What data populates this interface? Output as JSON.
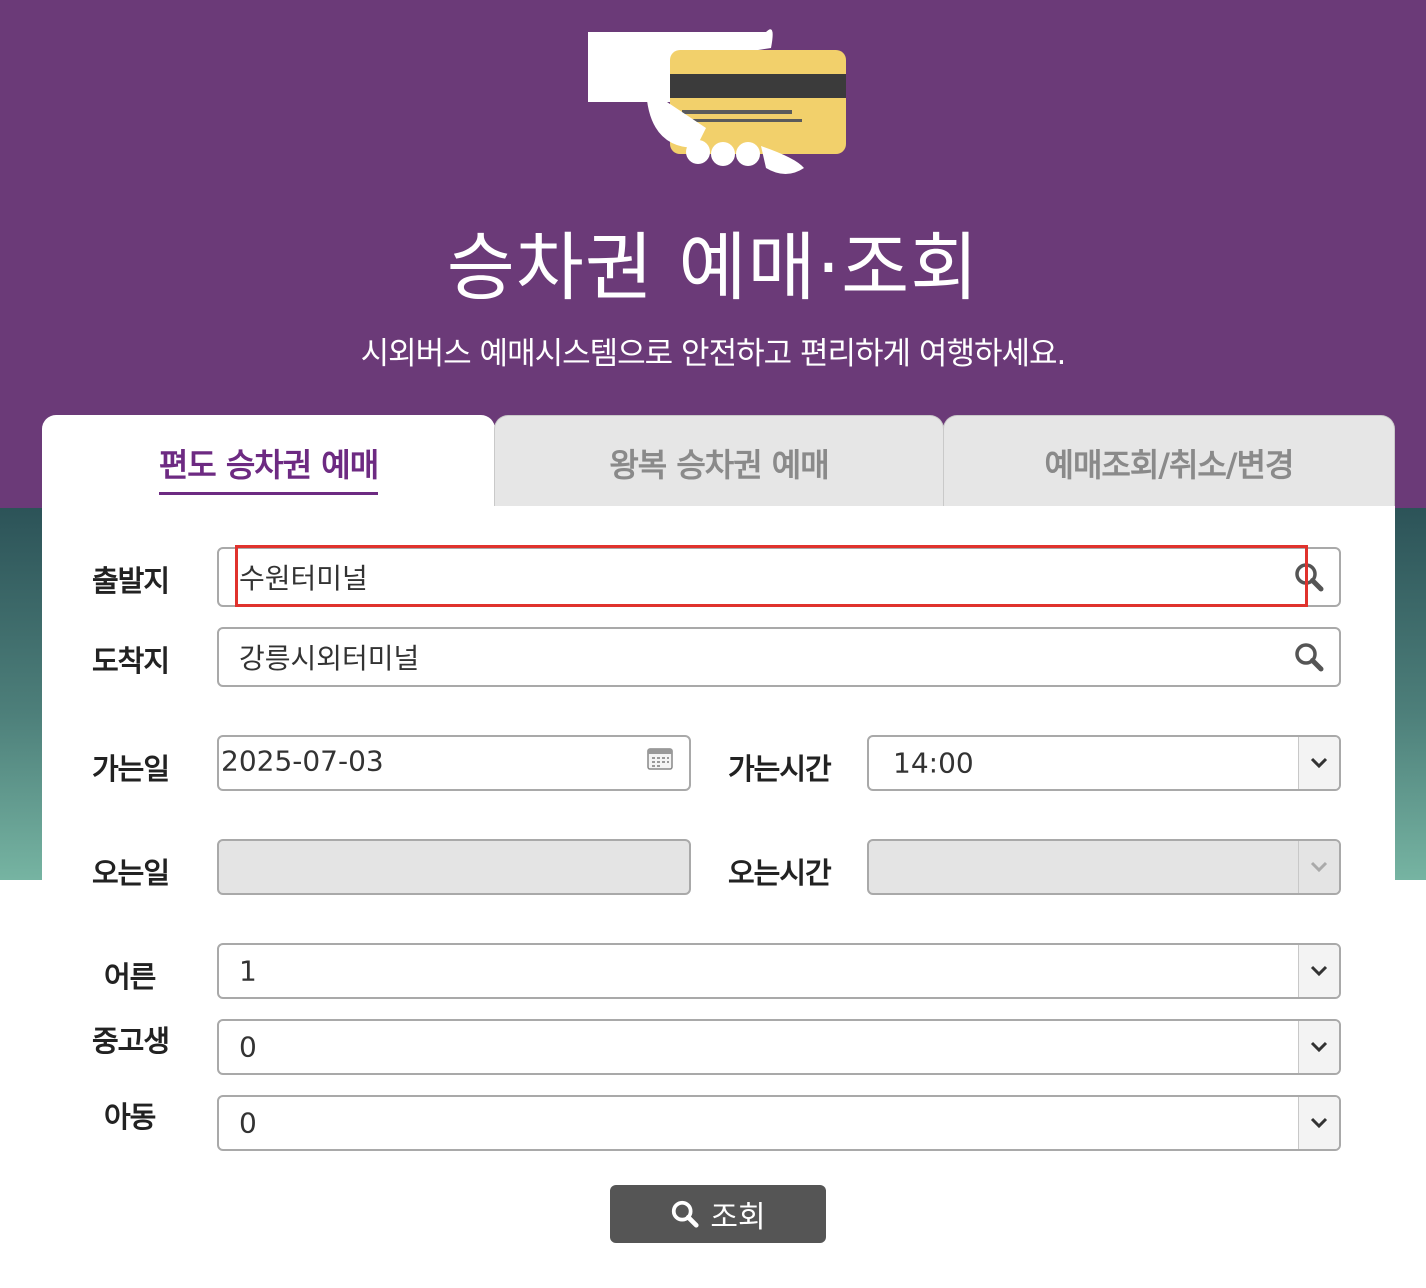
{
  "hero": {
    "title": "승차권 예매·조회",
    "subtitle": "시외버스 예매시스템으로 안전하고 편리하게 여행하세요."
  },
  "tabs": [
    {
      "label": "편도 승차권 예매",
      "active": true
    },
    {
      "label": "왕복 승차권 예매",
      "active": false
    },
    {
      "label": "예매조회/취소/변경",
      "active": false
    }
  ],
  "form": {
    "departure": {
      "label": "출발지",
      "value": "수원터미널"
    },
    "arrival": {
      "label": "도착지",
      "value": "강릉시외터미널"
    },
    "depart_date": {
      "label": "가는일",
      "value": "2025-07-03"
    },
    "depart_time": {
      "label": "가는시간",
      "value": "14:00"
    },
    "return_date": {
      "label": "오는일",
      "value": ""
    },
    "return_time": {
      "label": "오는시간",
      "value": ""
    },
    "adult": {
      "label": "어른",
      "value": "1"
    },
    "youth": {
      "label": "중고생",
      "value": "0"
    },
    "child": {
      "label": "아동",
      "value": "0"
    }
  },
  "search_button": {
    "label": "조회"
  },
  "colors": {
    "hero_bg": "#6b3a78",
    "active_tab_text": "#6d2a82",
    "highlight": "#e0322d",
    "button_bg": "#555555"
  },
  "icons": [
    "card-payment-illustration",
    "search-icon",
    "calendar-icon",
    "chevron-down-icon"
  ]
}
